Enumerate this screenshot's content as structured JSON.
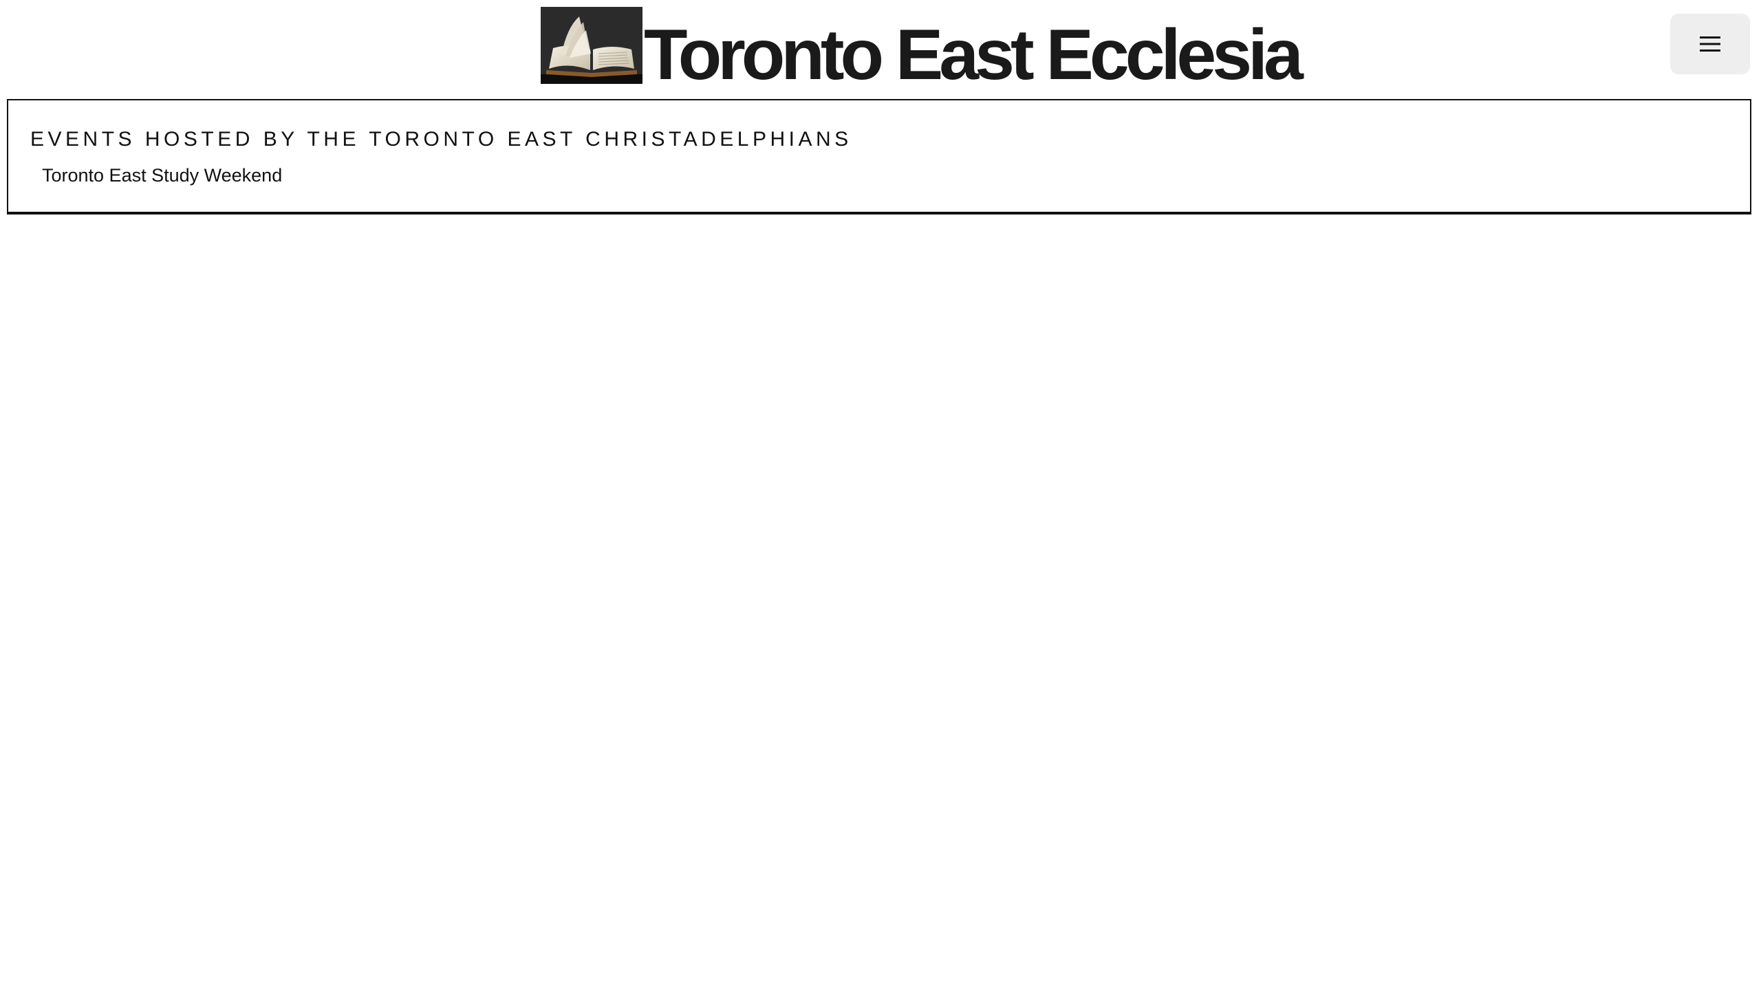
{
  "header": {
    "site_title": "Toronto East Ecclesia",
    "logo_icon": "open-bible-image",
    "menu_icon": "hamburger-menu-icon"
  },
  "events": {
    "heading": "EVENTS HOSTED BY THE TORONTO EAST CHRISTADELPHIANS",
    "items": [
      {
        "label": "Toronto East Study Weekend"
      }
    ]
  },
  "colors": {
    "text": "#111111",
    "title": "#1a1a1a",
    "menu_button_bg": "#eeeeee",
    "border": "#111111",
    "background": "#ffffff"
  }
}
